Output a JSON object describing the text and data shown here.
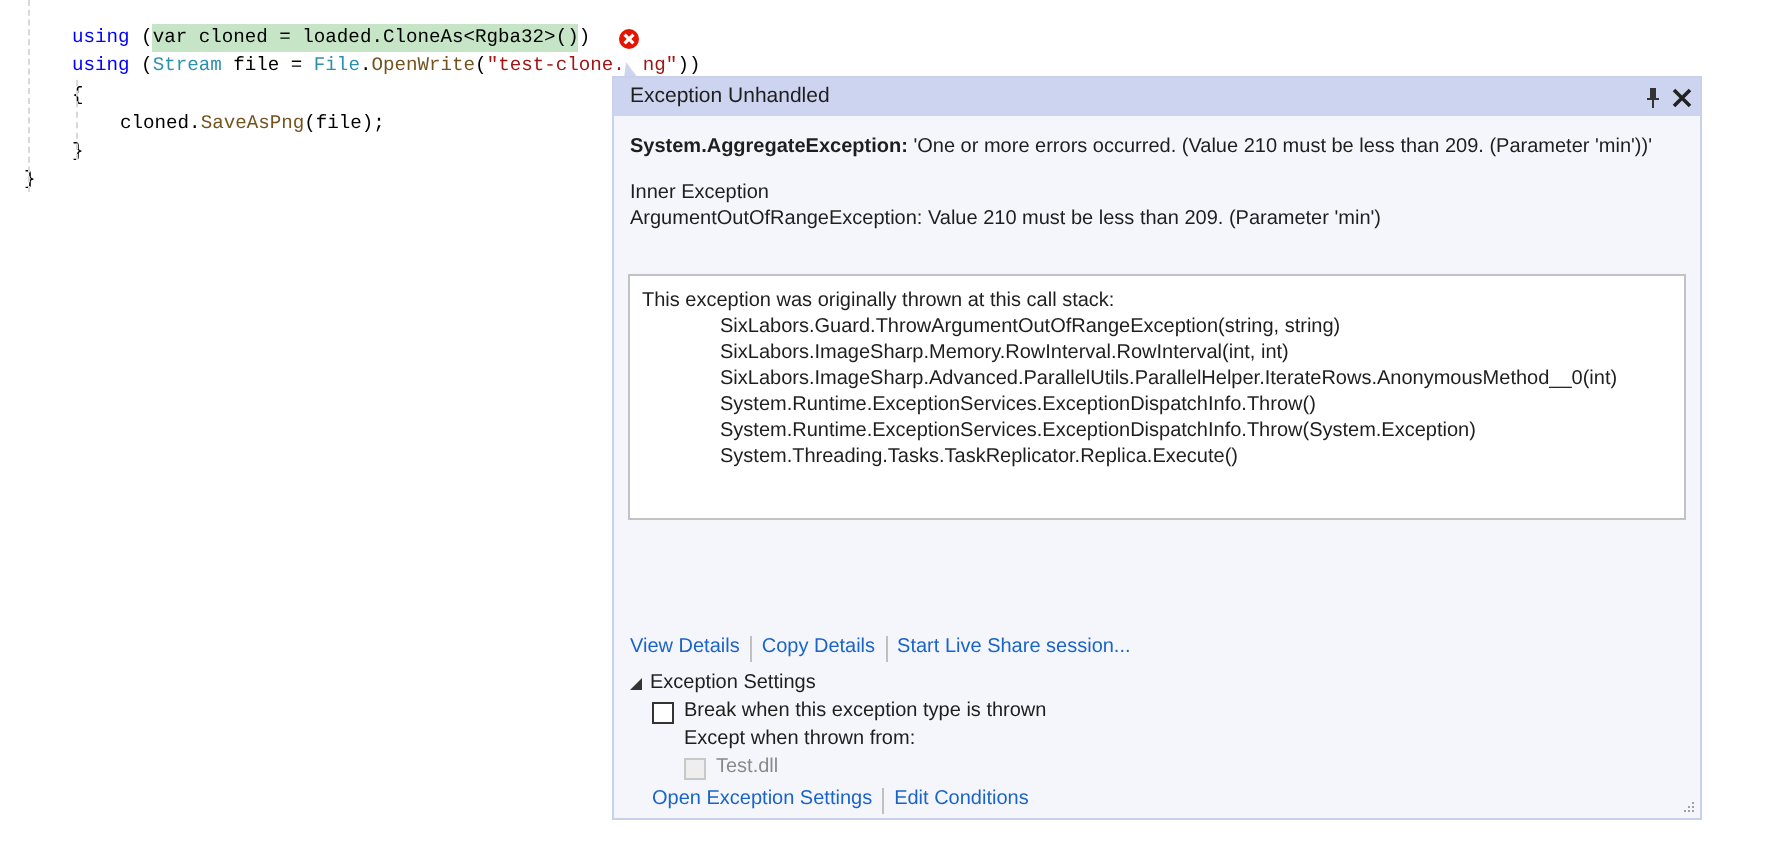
{
  "code": {
    "lines": [
      {
        "children": [
          {
            "error": true,
            "tokens": [
              {
                "kind": "keyword",
                "text": "using"
              },
              {
                "kind": "plain",
                "text": " ("
              },
              {
                "kind": "highlight",
                "text": "var cloned = loaded.CloneAs<Rgba32>()"
              },
              {
                "kind": "plain",
                "text": ")"
              }
            ]
          },
          {
            "error": false,
            "tokens": [
              {
                "kind": "keyword",
                "text": "using"
              },
              {
                "kind": "plain",
                "text": " ("
              },
              {
                "kind": "type",
                "text": "Stream"
              },
              {
                "kind": "plain",
                "text": " file = "
              },
              {
                "kind": "type",
                "text": "File"
              },
              {
                "kind": "plain",
                "text": "."
              },
              {
                "kind": "method",
                "text": "OpenWrite"
              },
              {
                "kind": "plain",
                "text": "("
              },
              {
                "kind": "string",
                "text": "\"test-clone."
              },
              {
                "kind": "tail"
              },
              {
                "kind": "string",
                "text": "ng\""
              },
              {
                "kind": "plain",
                "text": "))"
              }
            ]
          },
          {
            "error": false,
            "tokens": [
              {
                "kind": "plain",
                "text": "{"
              }
            ],
            "children": [
              {
                "error": false,
                "tokens": [
                  {
                    "kind": "plain",
                    "text": "cloned."
                  },
                  {
                    "kind": "method",
                    "text": "SaveAsPng"
                  },
                  {
                    "kind": "plain",
                    "text": "(file);"
                  }
                ]
              }
            ]
          },
          {
            "error": false,
            "tokens": [
              {
                "kind": "plain",
                "text": "}"
              }
            ]
          }
        ]
      },
      {
        "error": false,
        "tokens": [
          {
            "kind": "plain",
            "text": "}"
          }
        ]
      }
    ]
  },
  "popup": {
    "title": "Exception Unhandled",
    "exception_type": "System.AggregateException:",
    "exception_message": "'One or more errors occurred. (Value 210 must be less than 209. (Parameter 'min'))'",
    "inner_label": "Inner Exception",
    "inner_message": "ArgumentOutOfRangeException: Value 210 must be less than 209. (Parameter 'min')",
    "stack_heading": "This exception was originally thrown at this call stack:",
    "stack": [
      "SixLabors.Guard.ThrowArgumentOutOfRangeException(string, string)",
      "SixLabors.ImageSharp.Memory.RowInterval.RowInterval(int, int)",
      "SixLabors.ImageSharp.Advanced.ParallelUtils.ParallelHelper.IterateRows.AnonymousMethod__0(int)",
      "System.Runtime.ExceptionServices.ExceptionDispatchInfo.Throw()",
      "System.Runtime.ExceptionServices.ExceptionDispatchInfo.Throw(System.Exception)",
      "System.Threading.Tasks.TaskReplicator.Replica.Execute()"
    ],
    "links": [
      "View Details",
      "Copy Details",
      "Start Live Share session..."
    ],
    "settings": {
      "title": "Exception Settings",
      "expanded": true,
      "break_option": {
        "label": "Break when this exception type is thrown",
        "checked": false,
        "disabled": false
      },
      "except_label": "Except when thrown from:",
      "module_option": {
        "label": "Test.dll",
        "checked": false,
        "disabled": true
      },
      "links": [
        "Open Exception Settings",
        "Edit Conditions"
      ]
    }
  }
}
